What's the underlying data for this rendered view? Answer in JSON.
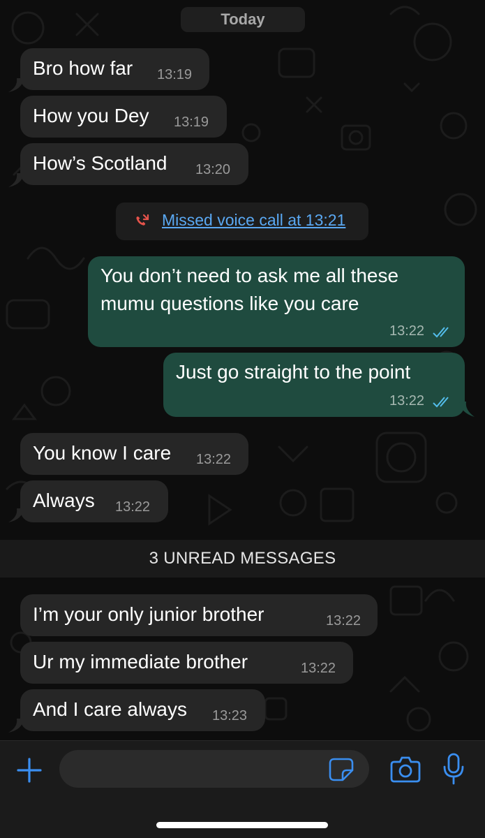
{
  "date_separator": "Today",
  "messages": [
    {
      "text": "Bro how far",
      "time": "13:19",
      "direction": "in"
    },
    {
      "text": "How you Dey",
      "time": "13:19",
      "direction": "in"
    },
    {
      "text": "How’s Scotland",
      "time": "13:20",
      "direction": "in"
    },
    {
      "text": "You don’t need to ask me all these mumu questions like you care",
      "time": "13:22",
      "direction": "out",
      "status": "read"
    },
    {
      "text": "Just go straight to the point",
      "time": "13:22",
      "direction": "out",
      "status": "read"
    },
    {
      "text": "You know I care",
      "time": "13:22",
      "direction": "in"
    },
    {
      "text": "Always",
      "time": "13:22",
      "direction": "in"
    },
    {
      "text": "I’m your only junior brother",
      "time": "13:22",
      "direction": "in"
    },
    {
      "text": "Ur my immediate brother",
      "time": "13:22",
      "direction": "in"
    },
    {
      "text": "And I care always",
      "time": "13:23",
      "direction": "in"
    }
  ],
  "missed_call": {
    "text": "Missed voice call at 13:21",
    "icon": "missed-call-icon"
  },
  "unread_banner": "3 UNREAD MESSAGES",
  "composer": {
    "placeholder": "",
    "icons": [
      "plus-icon",
      "sticker-icon",
      "camera-icon",
      "microphone-icon"
    ]
  },
  "colors": {
    "incoming_bubble": "#262626",
    "outgoing_bubble": "#1f4b3f",
    "accent": "#3a8ef0",
    "missed_call_red": "#e5534b",
    "read_ticks": "#53bdeb"
  }
}
